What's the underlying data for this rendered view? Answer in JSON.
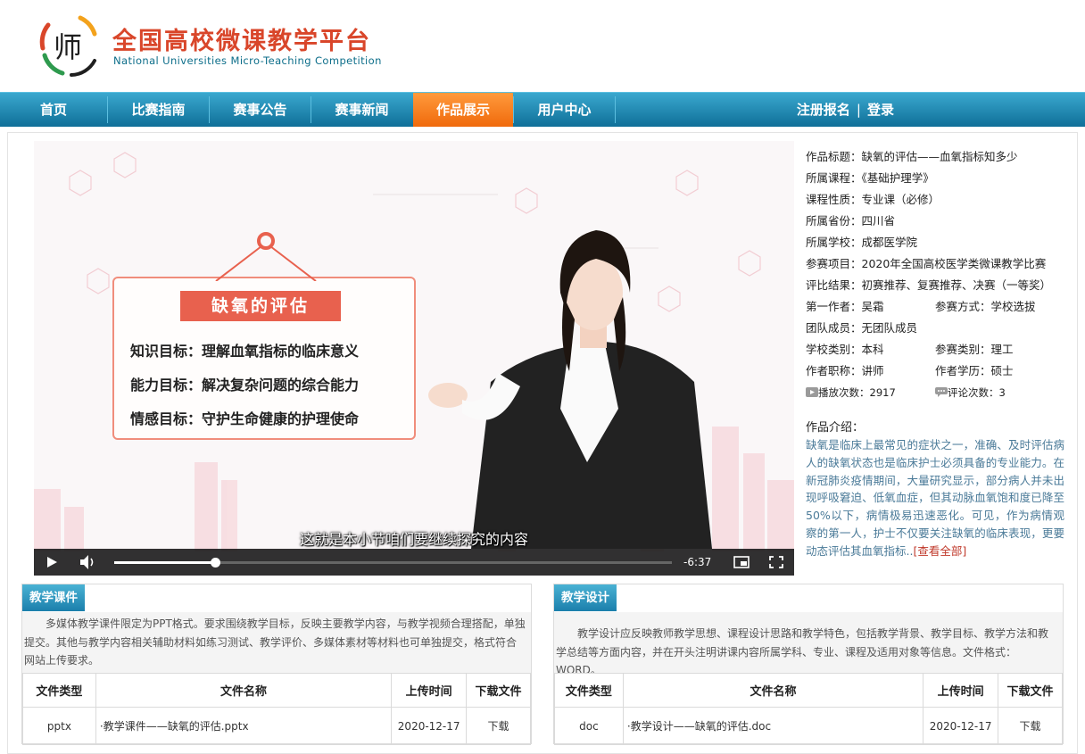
{
  "header": {
    "logo_cn": "全国高校微课教学平台",
    "logo_en": "National Universities Micro-Teaching Competition",
    "logo_glyph": "师"
  },
  "nav": {
    "items": [
      "首页",
      "比赛指南",
      "赛事公告",
      "赛事新闻",
      "作品展示",
      "用户中心"
    ],
    "active": "作品展示",
    "register": "注册报名",
    "separator": "|",
    "login": "登录"
  },
  "video": {
    "slide_title": "缺氧的评估",
    "goals": [
      "知识目标：理解血氧指标的临床意义",
      "能力目标：解决复杂问题的综合能力",
      "情感目标：守护生命健康的护理使命"
    ],
    "subtitle": "这就是本小节咱们要继续探究的内容",
    "time_remaining": "-6:37",
    "progress": 0.18
  },
  "info": {
    "title": "作品标题：缺氧的评估——血氧指标知多少",
    "course": "所属课程：《基础护理学》",
    "nature": "课程性质：专业课（必修）",
    "province": "所属省份：四川省",
    "school": "所属学校：成都医学院",
    "project": "参赛项目：2020年全国高校医学类微课教学比赛",
    "result": "评比结果：初赛推荐、复赛推荐、决赛（一等奖）",
    "author": "第一作者：吴霜",
    "entry_mode": "参赛方式：学校选拔",
    "team": "团队成员：无团队成员",
    "school_type": "学校类别：本科",
    "entry_type": "参赛类别：理工",
    "title_rank": "作者职称：讲师",
    "degree": "作者学历：硕士",
    "plays": "播放次数：2917",
    "comments": "评论次数：3",
    "intro_title": "作品介绍：",
    "intro_text": "缺氧是临床上最常见的症状之一，准确、及时评估病人的缺氧状态也是临床护士必须具备的专业能力。在新冠肺炎疫情期间，大量研究显示，部分病人并未出现呼吸窘迫、低氧血症，但其动脉血氧饱和度已降至50%以下，病情极易迅速恶化。可见，作为病情观察的第一人，护士不仅要关注缺氧的临床表现，更要动态评估其血氧指标..",
    "intro_more": "[查看全部]"
  },
  "courseware": {
    "title": "教学课件",
    "desc": "多媒体教学课件限定为PPT格式。要求围绕教学目标，反映主要教学内容，与教学视频合理搭配，单独提交。其他与教学内容相关辅助材料如练习测试、教学评价、多媒体素材等材料也可单独提交，格式符合网站上传要求。",
    "headers": [
      "文件类型",
      "文件名称",
      "上传时间",
      "下载文件"
    ],
    "row": [
      "pptx",
      "·教学课件——缺氧的评估.pptx",
      "2020-12-17",
      "下载"
    ]
  },
  "design": {
    "title": "教学设计",
    "desc": "教学设计应反映教师教学思想、课程设计思路和教学特色，包括教学背景、教学目标、教学方法和教学总结等方面内容，并在开头注明讲课内容所属学科、专业、课程及适用对象等信息。文件格式：WORD。",
    "headers": [
      "文件类型",
      "文件名称",
      "上传时间",
      "下载文件"
    ],
    "row": [
      "doc",
      "·教学设计——缺氧的评估.doc",
      "2020-12-17",
      "下载"
    ]
  },
  "colors": {
    "nav_blue": "#1a86b4",
    "nav_active": "#f47b20",
    "brand_red": "#d9462a",
    "intro_blue": "#4a7a98"
  }
}
